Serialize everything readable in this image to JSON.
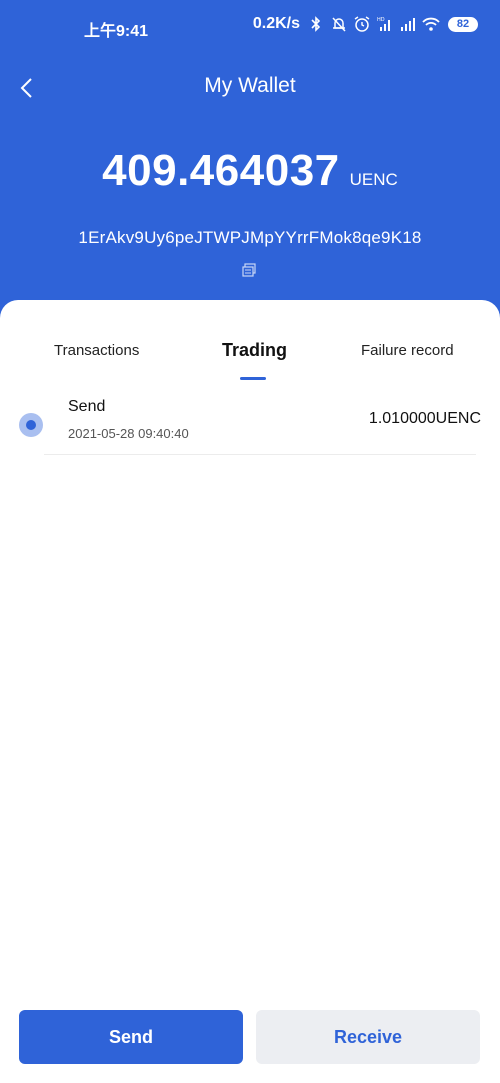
{
  "status_bar": {
    "time": "上午9:41",
    "network_speed": "0.2K/s",
    "battery": "82",
    "icons": [
      "bluetooth-icon",
      "mute-bell-icon",
      "alarm-icon",
      "hd-signal-icon",
      "signal-icon",
      "wifi-icon",
      "battery-icon"
    ]
  },
  "header": {
    "title": "My Wallet",
    "back_icon": "chevron-left-icon"
  },
  "wallet": {
    "balance": "409.464037",
    "unit": "UENC",
    "address": "1ErAkv9Uy6peJTWPJMpYYrrFMok8qe9K18",
    "copy_icon": "copy-icon"
  },
  "tabs": [
    {
      "label": "Transactions",
      "active": false
    },
    {
      "label": "Trading",
      "active": true
    },
    {
      "label": "Failure record",
      "active": false
    }
  ],
  "transactions": [
    {
      "type": "Send",
      "datetime": "2021-05-28 09:40:40",
      "amount": "1.010000UENC"
    }
  ],
  "actions": {
    "send_label": "Send",
    "receive_label": "Receive"
  },
  "colors": {
    "primary": "#2f63d8",
    "secondary_button_bg": "#eceef2",
    "card_bg": "#ffffff"
  }
}
